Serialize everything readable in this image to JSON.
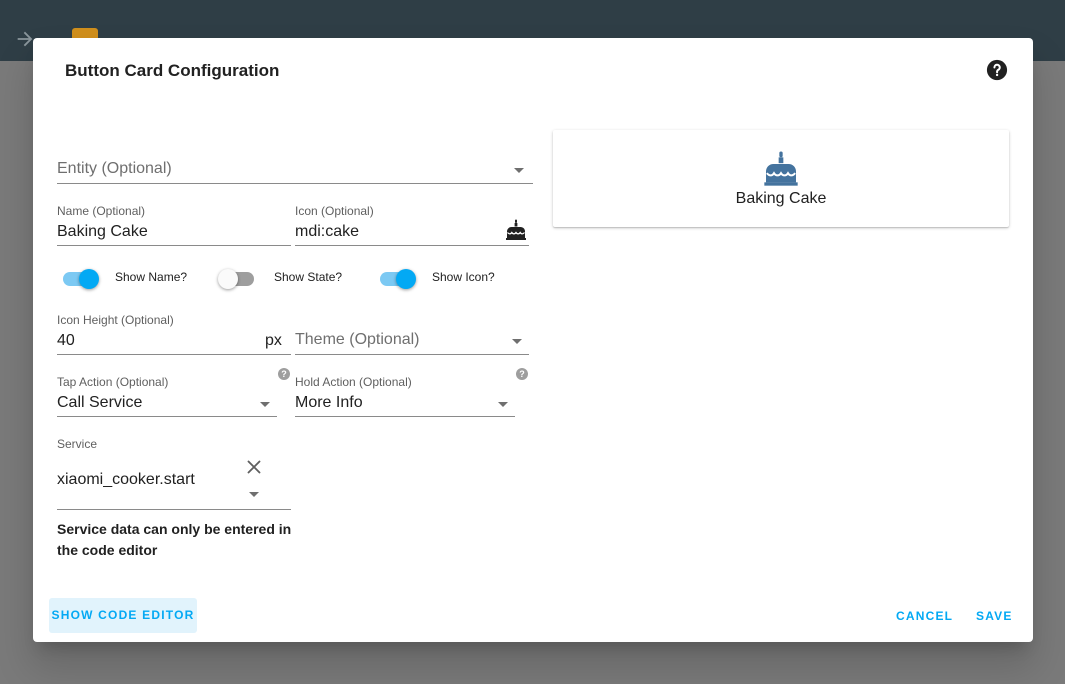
{
  "dialog": {
    "title": "Button Card Configuration"
  },
  "fields": {
    "entity": {
      "placeholder": "Entity (Optional)"
    },
    "name": {
      "label": "Name (Optional)",
      "value": "Baking Cake"
    },
    "icon": {
      "label": "Icon (Optional)",
      "value": "mdi:cake"
    },
    "icon_height": {
      "label": "Icon Height (Optional)",
      "value": "40",
      "suffix": "px"
    },
    "theme": {
      "placeholder": "Theme (Optional)"
    },
    "tap_action": {
      "label": "Tap Action (Optional)",
      "value": "Call Service"
    },
    "hold_action": {
      "label": "Hold Action (Optional)",
      "value": "More Info"
    },
    "service": {
      "label": "Service",
      "value": "xiaomi_cooker.start"
    }
  },
  "toggles": {
    "show_name": {
      "label": "Show Name?",
      "on": true
    },
    "show_state": {
      "label": "Show State?",
      "on": false
    },
    "show_icon": {
      "label": "Show Icon?",
      "on": true
    }
  },
  "help_mark": "?",
  "note": "Service data can only be entered in the code editor",
  "buttons": {
    "show_code_editor": "Show Code Editor",
    "cancel": "Cancel",
    "save": "Save"
  },
  "preview": {
    "name": "Baking Cake",
    "icon": "cake-icon",
    "icon_color": "#44739e"
  },
  "colors": {
    "accent": "#03a9f4",
    "header": "#2f3e46"
  }
}
